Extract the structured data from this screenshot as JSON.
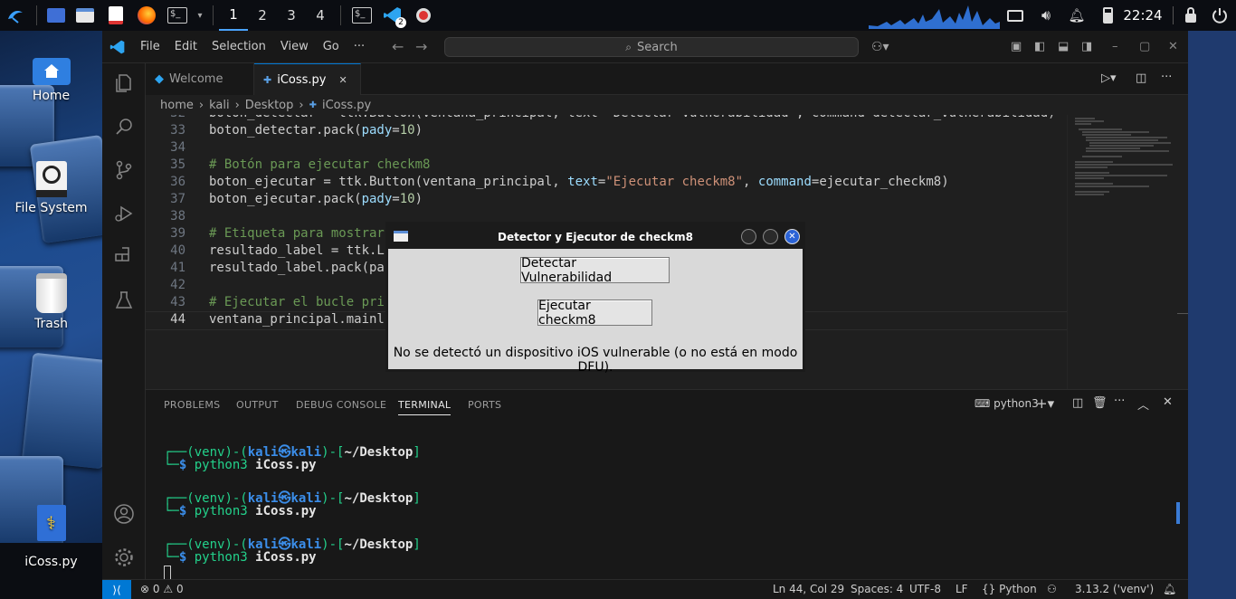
{
  "panel": {
    "workspaces": [
      "1",
      "2",
      "3",
      "4"
    ],
    "clock": "22:24"
  },
  "desktop": {
    "icons": [
      {
        "label": "Home"
      },
      {
        "label": "File System"
      },
      {
        "label": "Trash"
      },
      {
        "label": "iCoss.py"
      }
    ]
  },
  "vscode": {
    "menu": [
      "File",
      "Edit",
      "Selection",
      "View",
      "Go",
      "···"
    ],
    "search_placeholder": "Search",
    "tabs": [
      {
        "label": "Welcome"
      },
      {
        "label": "iCoss.py",
        "close": "✕"
      }
    ],
    "breadcrumb": [
      "home",
      "kali",
      "Desktop",
      "iCoss.py"
    ],
    "code": [
      {
        "ln": "32",
        "parts": [
          [
            "",
            "boton_detectar = ttk.Button(ventana_principal, text=\"Detectar Vulnerabilidad\", command=detectar_vulnerabilidad)"
          ]
        ]
      },
      {
        "ln": "33",
        "parts": [
          [
            "",
            "boton_detectar.pack("
          ],
          [
            "kw",
            "pady"
          ],
          [
            "",
            "="
          ],
          [
            "nm",
            "10"
          ],
          [
            "",
            ")"
          ]
        ]
      },
      {
        "ln": "34",
        "parts": []
      },
      {
        "ln": "35",
        "parts": [
          [
            "cm",
            "# Botón para ejecutar checkm8"
          ]
        ]
      },
      {
        "ln": "36",
        "parts": [
          [
            "",
            "boton_ejecutar = ttk.Button(ventana_principal, "
          ],
          [
            "kw",
            "text"
          ],
          [
            "",
            "="
          ],
          [
            "st",
            "\"Ejecutar checkm8\""
          ],
          [
            "",
            ", "
          ],
          [
            "kw",
            "command"
          ],
          [
            "",
            "=ejecutar_checkm8)"
          ]
        ]
      },
      {
        "ln": "37",
        "parts": [
          [
            "",
            "boton_ejecutar.pack("
          ],
          [
            "kw",
            "pady"
          ],
          [
            "",
            "="
          ],
          [
            "nm",
            "10"
          ],
          [
            "",
            ")"
          ]
        ]
      },
      {
        "ln": "38",
        "parts": []
      },
      {
        "ln": "39",
        "parts": [
          [
            "cm",
            "# Etiqueta para mostrar"
          ]
        ]
      },
      {
        "ln": "40",
        "parts": [
          [
            "",
            "resultado_label = ttk.L"
          ]
        ]
      },
      {
        "ln": "41",
        "parts": [
          [
            "",
            "resultado_label.pack(pa"
          ]
        ]
      },
      {
        "ln": "42",
        "parts": []
      },
      {
        "ln": "43",
        "parts": [
          [
            "cm",
            "# Ejecutar el bucle pri"
          ]
        ]
      },
      {
        "ln": "44",
        "parts": [
          [
            "",
            "ventana_principal.mainl"
          ]
        ]
      }
    ],
    "panel_tabs": [
      "PROBLEMS",
      "OUTPUT",
      "DEBUG CONSOLE",
      "TERMINAL",
      "PORTS"
    ],
    "terminal_name": "python3",
    "terminal": {
      "prompt_venv": "(venv)",
      "prompt_user": "kali",
      "prompt_at": "㉿",
      "prompt_host": "kali",
      "prompt_dir": "~/Desktop",
      "command": "python3",
      "arg": "iCoss.py"
    },
    "status": {
      "errors": "0",
      "warnings": "0",
      "position": "Ln 44, Col 29",
      "spaces": "Spaces: 4",
      "encoding": "UTF-8",
      "eol": "LF",
      "language": "Python",
      "interpreter": "3.13.2 ('venv')"
    }
  },
  "dialog": {
    "title": "Detector y Ejecutor de checkm8",
    "button1": "Detectar Vulnerabilidad",
    "button2": "Ejecutar checkm8",
    "result": "No se detectó un dispositivo iOS vulnerable (o no está en modo DFU)."
  }
}
